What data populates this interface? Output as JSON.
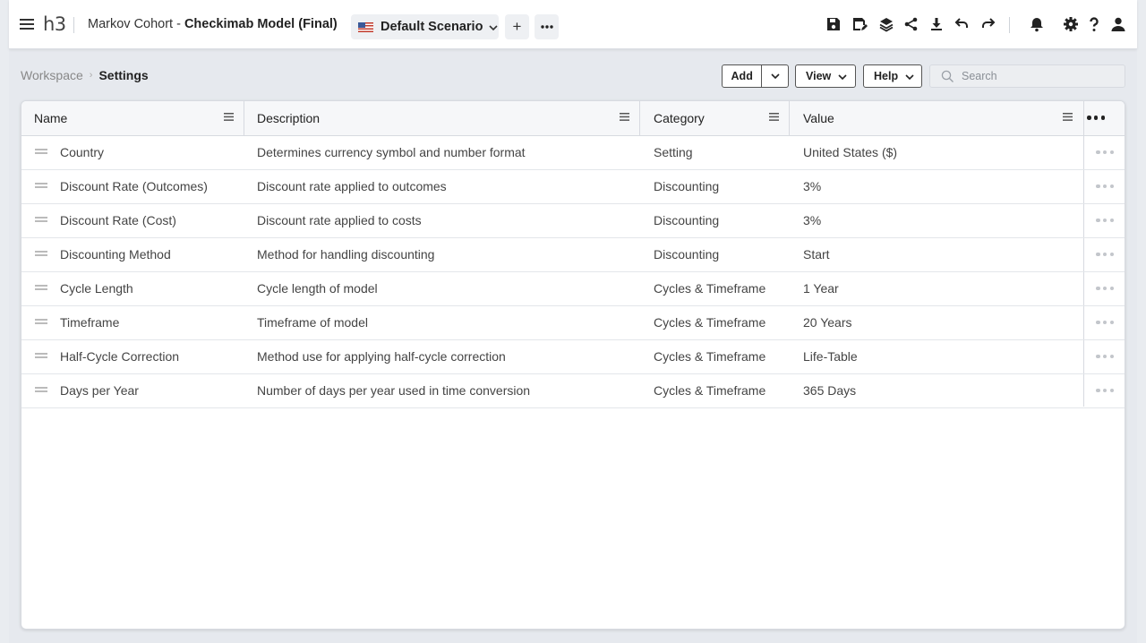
{
  "header": {
    "logo": "h3",
    "project_prefix": "Markov Cohort",
    "project_dash": "-",
    "model_name": "Checkimab Model (Final)",
    "scenario": "Default Scenario",
    "add_symbol": "+",
    "icons": [
      "menu-icon",
      "save-icon",
      "save-as-icon",
      "layers-icon",
      "share-icon",
      "download-icon",
      "undo-icon",
      "redo-icon",
      "bell-icon",
      "gear-icon",
      "help-icon",
      "user-icon"
    ]
  },
  "breadcrumb": {
    "root": "Workspace",
    "current": "Settings"
  },
  "toolbar": {
    "add_label": "Add",
    "view_label": "View",
    "help_label": "Help",
    "search_placeholder": "Search"
  },
  "table": {
    "columns": [
      "Name",
      "Description",
      "Category",
      "Value"
    ],
    "rows": [
      [
        "Country",
        "Determines currency symbol and number format",
        "Setting",
        "United States ($)"
      ],
      [
        "Discount Rate (Outcomes)",
        "Discount rate applied to outcomes",
        "Discounting",
        "3%"
      ],
      [
        "Discount Rate (Cost)",
        "Discount rate applied to costs",
        "Discounting",
        "3%"
      ],
      [
        "Discounting Method",
        "Method for handling discounting",
        "Discounting",
        "Start"
      ],
      [
        "Cycle Length",
        "Cycle length of model",
        "Cycles & Timeframe",
        "1 Year"
      ],
      [
        "Timeframe",
        "Timeframe of model",
        "Cycles & Timeframe",
        "20 Years"
      ],
      [
        "Half-Cycle Correction",
        "Method use for applying half-cycle correction",
        "Cycles & Timeframe",
        "Life-Table"
      ],
      [
        "Days per Year",
        "Number of days per year used in time conversion",
        "Cycles & Timeframe",
        "365 Days"
      ]
    ]
  }
}
